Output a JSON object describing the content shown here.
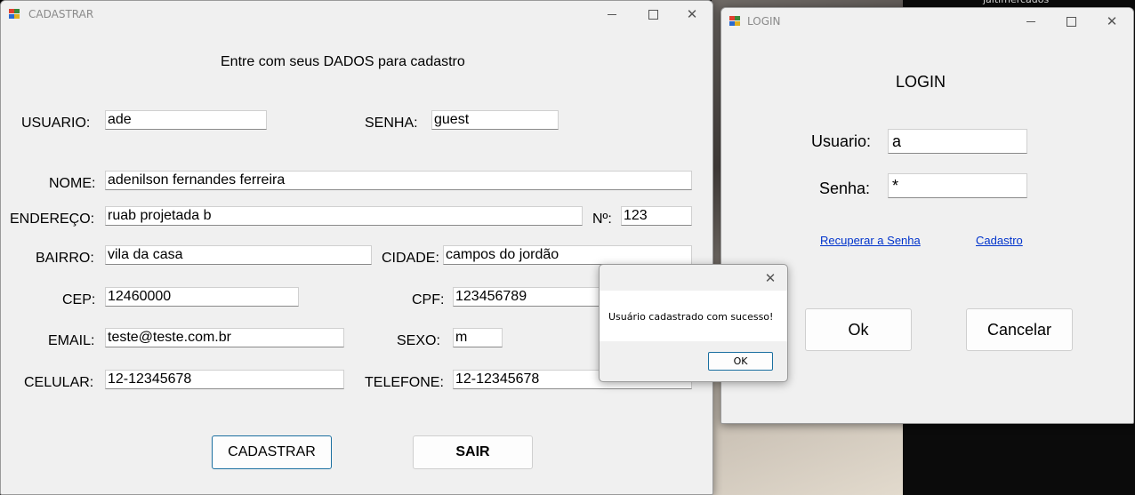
{
  "desktop": {
    "background_text": "jaltimercados"
  },
  "cadastrar": {
    "title": "CADASTRAR",
    "heading": "Entre com seus DADOS para cadastro",
    "labels": {
      "usuario": "USUARIO:",
      "senha": "SENHA:",
      "nome": "NOME:",
      "endereco": "ENDEREÇO:",
      "numero": "Nº:",
      "bairro": "BAIRRO:",
      "cidade": "CIDADE:",
      "cep": "CEP:",
      "cpf": "CPF:",
      "email": "EMAIL:",
      "sexo": "SEXO:",
      "celular": "CELULAR:",
      "telefone": "TELEFONE:"
    },
    "values": {
      "usuario": "ade",
      "senha": "guest",
      "nome": "adenilson fernandes ferreira",
      "endereco": "ruab projetada b",
      "numero": "123",
      "bairro": "vila da casa",
      "cidade": "campos do jordão",
      "cep": "12460000",
      "cpf": "123456789",
      "email": "teste@teste.com.br",
      "sexo": "m",
      "celular": "12-12345678",
      "telefone": "12-12345678"
    },
    "buttons": {
      "cadastrar": "CADASTRAR",
      "sair": "SAIR"
    }
  },
  "login": {
    "title": "LOGIN",
    "heading": "LOGIN",
    "labels": {
      "usuario": "Usuario:",
      "senha": "Senha:"
    },
    "values": {
      "usuario": "a",
      "senha": "*"
    },
    "links": {
      "recuperar": "Recuperar a Senha",
      "cadastro": "Cadastro"
    },
    "buttons": {
      "ok": "Ok",
      "cancelar": "Cancelar"
    }
  },
  "message_box": {
    "message": "Usuário cadastrado com sucesso!",
    "ok_label": "OK"
  },
  "colors": {
    "link": "#0033cc",
    "window_bg": "#f0f0f0",
    "focus_border": "#1a6fa0"
  }
}
